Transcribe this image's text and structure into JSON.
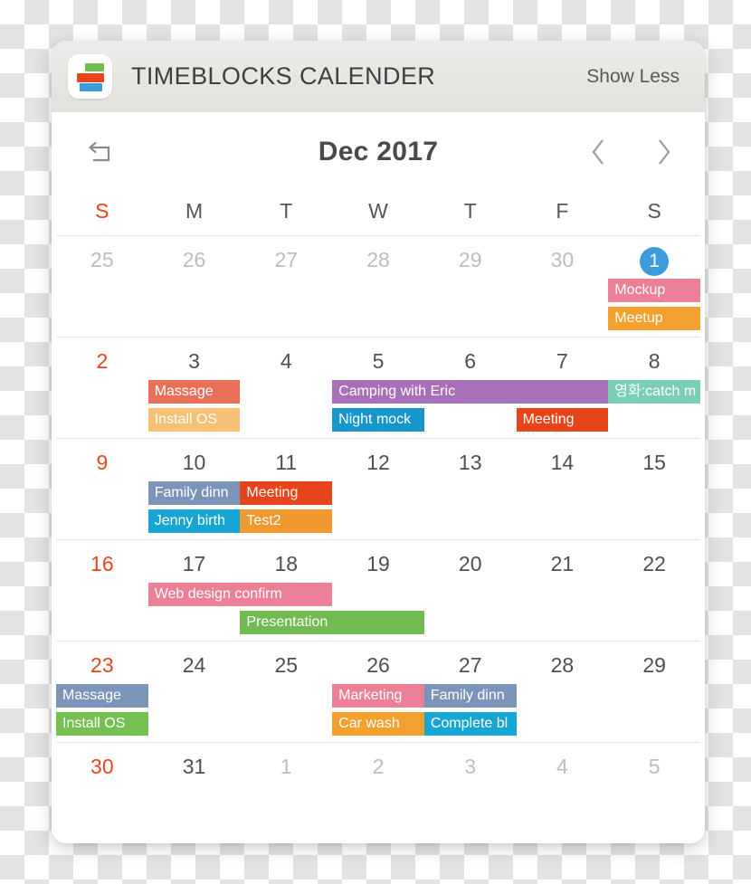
{
  "header": {
    "app_title": "TIMEBLOCKS CALENDER",
    "show_less_label": "Show Less",
    "icon_name": "timeblocks-logo"
  },
  "nav": {
    "undo_icon": "undo-return-arrow-icon",
    "month_title": "Dec 2017",
    "prev_icon": "chevron-left-icon",
    "next_icon": "chevron-right-icon"
  },
  "weekdays": [
    "S",
    "M",
    "T",
    "W",
    "T",
    "F",
    "S"
  ],
  "colors": {
    "sunday": "#e8441c",
    "today_circle": "#3b9cd9",
    "outside_day": "#bdbdbd",
    "normal_day": "#4f4f4f",
    "grid_line": "#e4e4e4"
  },
  "weeks": [
    {
      "days": [
        {
          "label": "25",
          "type": "outside"
        },
        {
          "label": "26",
          "type": "outside"
        },
        {
          "label": "27",
          "type": "outside"
        },
        {
          "label": "28",
          "type": "outside"
        },
        {
          "label": "29",
          "type": "outside"
        },
        {
          "label": "30",
          "type": "outside"
        },
        {
          "label": "1",
          "type": "today"
        }
      ],
      "events": [
        {
          "title": "Mockup",
          "color": "#ec8098",
          "start": 6,
          "span": 1,
          "lane": 0
        },
        {
          "title": "Meetup",
          "color": "#f4a02e",
          "start": 6,
          "span": 1,
          "lane": 1
        }
      ]
    },
    {
      "days": [
        {
          "label": "2",
          "type": "sunday"
        },
        {
          "label": "3",
          "type": "normal"
        },
        {
          "label": "4",
          "type": "normal"
        },
        {
          "label": "5",
          "type": "normal"
        },
        {
          "label": "6",
          "type": "normal"
        },
        {
          "label": "7",
          "type": "normal"
        },
        {
          "label": "8",
          "type": "normal"
        }
      ],
      "events": [
        {
          "title": "Massage",
          "color": "#e8705a",
          "start": 1,
          "span": 1,
          "lane": 0
        },
        {
          "title": "Camping with Eric",
          "color": "#a870b8",
          "start": 3,
          "span": 3,
          "lane": 0
        },
        {
          "title": "영화:catch m",
          "color": "#7ccdb7",
          "start": 6,
          "span": 1,
          "lane": 0
        },
        {
          "title": "Install OS",
          "color": "#f5c175",
          "start": 1,
          "span": 1,
          "lane": 1
        },
        {
          "title": "Night mock",
          "color": "#1796cc",
          "start": 3,
          "span": 1,
          "lane": 1
        },
        {
          "title": "Meeting",
          "color": "#e8441c",
          "start": 5,
          "span": 1,
          "lane": 1
        }
      ]
    },
    {
      "days": [
        {
          "label": "9",
          "type": "sunday"
        },
        {
          "label": "10",
          "type": "normal"
        },
        {
          "label": "11",
          "type": "normal"
        },
        {
          "label": "12",
          "type": "normal"
        },
        {
          "label": "13",
          "type": "normal"
        },
        {
          "label": "14",
          "type": "normal"
        },
        {
          "label": "15",
          "type": "normal"
        }
      ],
      "events": [
        {
          "title": "Family dinn",
          "color": "#7a95b8",
          "start": 1,
          "span": 1,
          "lane": 0
        },
        {
          "title": "Meeting",
          "color": "#e8441c",
          "start": 2,
          "span": 1,
          "lane": 0
        },
        {
          "title": "Jenny birth",
          "color": "#17a5d4",
          "start": 1,
          "span": 1,
          "lane": 1
        },
        {
          "title": "Test2",
          "color": "#f0992e",
          "start": 2,
          "span": 1,
          "lane": 1
        }
      ]
    },
    {
      "days": [
        {
          "label": "16",
          "type": "sunday"
        },
        {
          "label": "17",
          "type": "normal"
        },
        {
          "label": "18",
          "type": "normal"
        },
        {
          "label": "19",
          "type": "normal"
        },
        {
          "label": "20",
          "type": "normal"
        },
        {
          "label": "21",
          "type": "normal"
        },
        {
          "label": "22",
          "type": "normal"
        }
      ],
      "events": [
        {
          "title": "Web design confirm",
          "color": "#ec8098",
          "start": 1,
          "span": 2,
          "lane": 0
        },
        {
          "title": "Presentation",
          "color": "#72bb53",
          "start": 2,
          "span": 2,
          "lane": 1
        }
      ]
    },
    {
      "days": [
        {
          "label": "23",
          "type": "sunday"
        },
        {
          "label": "24",
          "type": "normal"
        },
        {
          "label": "25",
          "type": "normal"
        },
        {
          "label": "26",
          "type": "normal"
        },
        {
          "label": "27",
          "type": "normal"
        },
        {
          "label": "28",
          "type": "normal"
        },
        {
          "label": "29",
          "type": "normal"
        }
      ],
      "events": [
        {
          "title": "Massage",
          "color": "#7a95b8",
          "start": 0,
          "span": 1,
          "lane": 0
        },
        {
          "title": "Marketing",
          "color": "#ec8098",
          "start": 3,
          "span": 1,
          "lane": 0
        },
        {
          "title": "Family dinn",
          "color": "#7a95b8",
          "start": 4,
          "span": 1,
          "lane": 0
        },
        {
          "title": "Install OS",
          "color": "#76bf53",
          "start": 0,
          "span": 1,
          "lane": 1
        },
        {
          "title": "Car wash",
          "color": "#f4a02e",
          "start": 3,
          "span": 1,
          "lane": 1
        },
        {
          "title": "Complete bl",
          "color": "#17a5d4",
          "start": 4,
          "span": 1,
          "lane": 1
        }
      ]
    },
    {
      "days": [
        {
          "label": "30",
          "type": "sunday"
        },
        {
          "label": "31",
          "type": "normal"
        },
        {
          "label": "1",
          "type": "outside"
        },
        {
          "label": "2",
          "type": "outside"
        },
        {
          "label": "3",
          "type": "outside"
        },
        {
          "label": "4",
          "type": "outside"
        },
        {
          "label": "5",
          "type": "outside"
        }
      ],
      "events": []
    }
  ]
}
